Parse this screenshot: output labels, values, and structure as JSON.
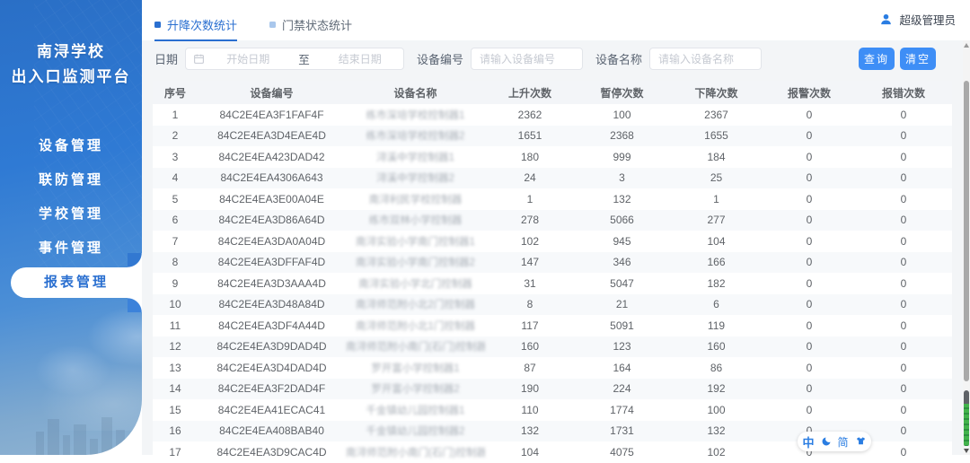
{
  "app": {
    "title_line1": "南浔学校",
    "title_line2": "出入口监测平台",
    "user": "超级管理员"
  },
  "sidebar": {
    "items": [
      {
        "label": "设备管理",
        "active": false
      },
      {
        "label": "联防管理",
        "active": false
      },
      {
        "label": "学校管理",
        "active": false
      },
      {
        "label": "事件管理",
        "active": false
      },
      {
        "label": "报表管理",
        "active": true
      }
    ]
  },
  "tabs": [
    {
      "label": "升降次数统计",
      "active": true
    },
    {
      "label": "门禁状态统计",
      "active": false
    }
  ],
  "filters": {
    "date_label": "日期",
    "date_start_placeholder": "开始日期",
    "date_separator": "至",
    "date_end_placeholder": "结束日期",
    "device_id_label": "设备编号",
    "device_id_placeholder": "请输入设备编号",
    "device_name_label": "设备名称",
    "device_name_placeholder": "请输入设备名称",
    "search_button": "查询",
    "clear_button": "清空"
  },
  "table": {
    "columns": [
      "序号",
      "设备编号",
      "设备名称",
      "上升次数",
      "暂停次数",
      "下降次数",
      "报警次数",
      "报错次数"
    ],
    "col_keys": [
      "index",
      "device-id",
      "device-name",
      "up-count",
      "pause-count",
      "down-count",
      "alarm-count",
      "error-count"
    ],
    "rows": [
      [
        "1",
        "84C2E4EA3F1FAF4F",
        "练市深培学校控制器1",
        "2362",
        "100",
        "2367",
        "0",
        "0"
      ],
      [
        "2",
        "84C2E4EA3D4EAE4D",
        "练市深培学校控制器2",
        "1651",
        "2368",
        "1655",
        "0",
        "0"
      ],
      [
        "3",
        "84C2E4EA423DAD42",
        "浔溪中学控制器1",
        "180",
        "999",
        "184",
        "0",
        "0"
      ],
      [
        "4",
        "84C2E4EA4306A643",
        "浔溪中学控制器2",
        "24",
        "3",
        "25",
        "0",
        "0"
      ],
      [
        "5",
        "84C2E4EA3E00A04E",
        "南浔利民学校控制器",
        "1",
        "132",
        "1",
        "0",
        "0"
      ],
      [
        "6",
        "84C2E4EA3D86A64D",
        "练市双林小学控制器",
        "278",
        "5066",
        "277",
        "0",
        "0"
      ],
      [
        "7",
        "84C2E4EA3DA0A04D",
        "南浔实验小学南门控制器1",
        "102",
        "945",
        "104",
        "0",
        "0"
      ],
      [
        "8",
        "84C2E4EA3DFFAF4D",
        "南浔实验小学南门控制器2",
        "147",
        "346",
        "166",
        "0",
        "0"
      ],
      [
        "9",
        "84C2E4EA3D3AAA4D",
        "南浔实验小学北门控制器",
        "31",
        "5047",
        "182",
        "0",
        "0"
      ],
      [
        "10",
        "84C2E4EA3D48A84D",
        "南浔师范附小北2门控制器",
        "8",
        "21",
        "6",
        "0",
        "0"
      ],
      [
        "11",
        "84C2E4EA3DF4A44D",
        "南浔师范附小北1门控制器",
        "117",
        "5091",
        "119",
        "0",
        "0"
      ],
      [
        "12",
        "84C2E4EA3D9DAD4D",
        "南浔师范附小南门(石门)控制器1",
        "160",
        "123",
        "160",
        "0",
        "0"
      ],
      [
        "13",
        "84C2E4EA3D4DAD4D",
        "罗开富小学控制器1",
        "87",
        "164",
        "86",
        "0",
        "0"
      ],
      [
        "14",
        "84C2E4EA3F2DAD4F",
        "罗开富小学控制器2",
        "190",
        "224",
        "192",
        "0",
        "0"
      ],
      [
        "15",
        "84C2E4EA41ECAC41",
        "千金镇幼儿园控制器1",
        "110",
        "1774",
        "100",
        "0",
        "0"
      ],
      [
        "16",
        "84C2E4EA408BAB40",
        "千金镇幼儿园控制器2",
        "132",
        "1731",
        "132",
        "0",
        "0"
      ],
      [
        "17",
        "84C2E4EA3D9CAC4D",
        "南浔师范附小南门(石门)控制器2",
        "104",
        "4075",
        "102",
        "0",
        "0"
      ]
    ]
  },
  "ime": {
    "chinese": "中",
    "simplified": "简"
  },
  "colors": {
    "accent": "#2a6fd0",
    "button_blue": "#3e8ef6",
    "sidebar_top": "#2a6fc6",
    "sidebar_bottom": "#8fb3d2",
    "table_header_bg": "#f3f5f8",
    "zebra_bg": "#f7f9fb",
    "ime_green": "#43b34c"
  }
}
